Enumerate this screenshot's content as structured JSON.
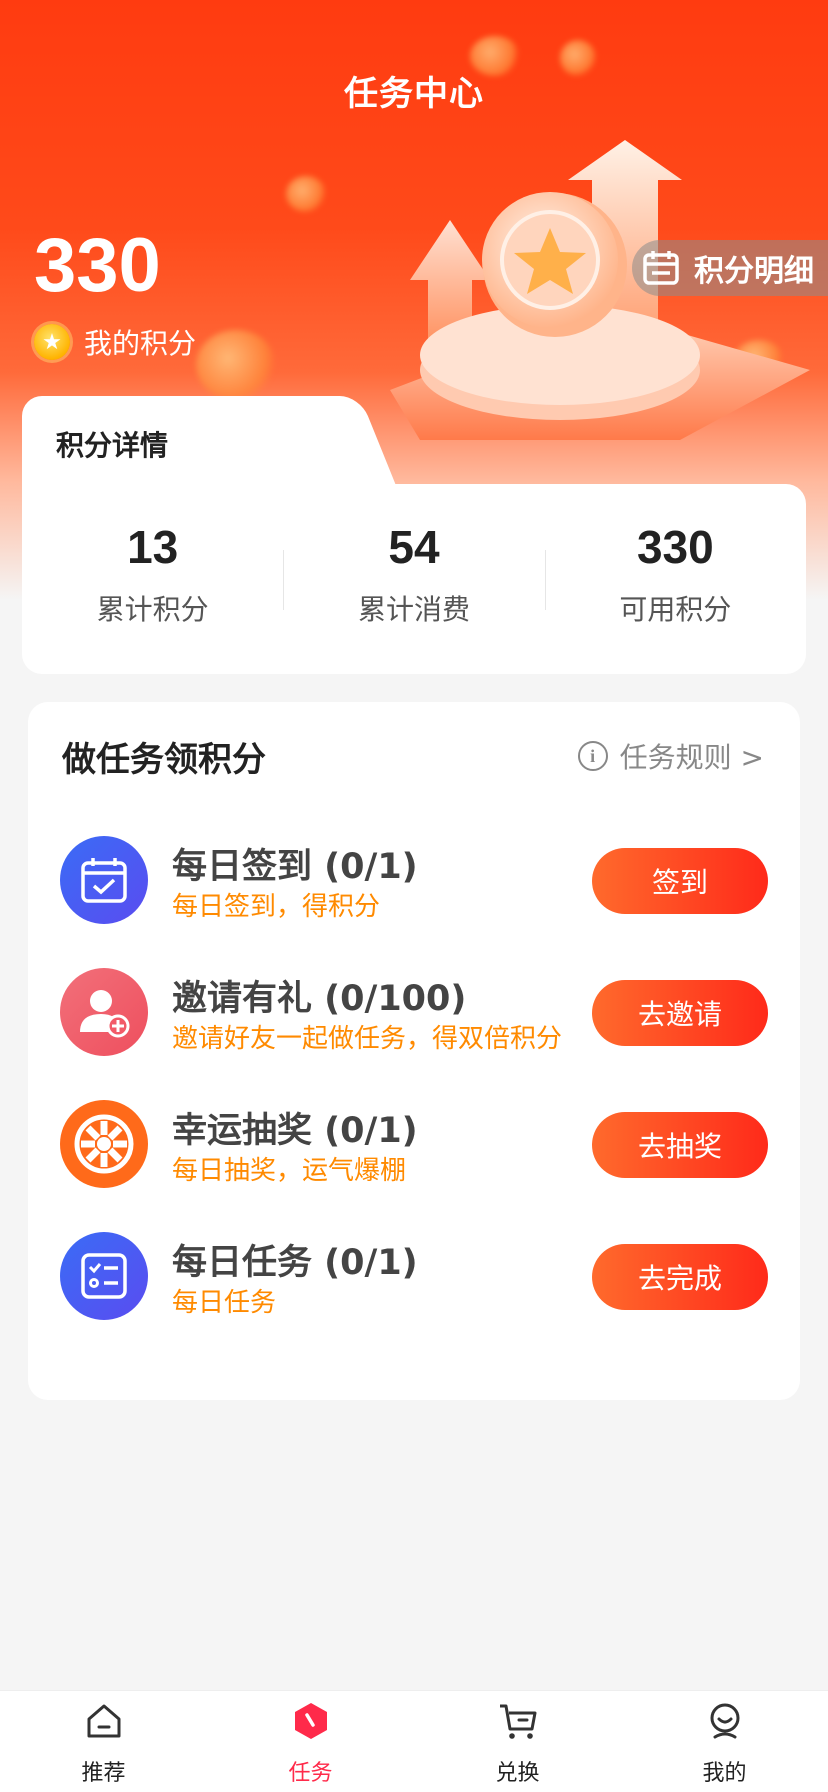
{
  "header": {
    "title": "任务中心"
  },
  "points": {
    "value": "330",
    "label": "我的积分"
  },
  "detail_link": {
    "label": "积分明细"
  },
  "points_detail": {
    "title": "积分详情",
    "stats": [
      {
        "value": "13",
        "label": "累计积分"
      },
      {
        "value": "54",
        "label": "累计消费"
      },
      {
        "value": "330",
        "label": "可用积分"
      }
    ]
  },
  "tasks": {
    "title": "做任务领积分",
    "rules_label": "任务规则 >",
    "items": [
      {
        "name": "每日签到 (0/1)",
        "desc": "每日签到，得积分",
        "button": "签到",
        "icon": "calendar-check-icon",
        "color": "#4a6cf7"
      },
      {
        "name": "邀请有礼 (0/100)",
        "desc": "邀请好友一起做任务，得双倍积分",
        "button": "去邀请",
        "icon": "invite-user-icon",
        "color": "#f25a68"
      },
      {
        "name": "幸运抽奖 (0/1)",
        "desc": "每日抽奖，运气爆棚",
        "button": "去抽奖",
        "icon": "lottery-wheel-icon",
        "color": "#ff6a1a"
      },
      {
        "name": "每日任务 (0/1)",
        "desc": "每日任务",
        "button": "去完成",
        "icon": "task-list-icon",
        "color": "#4a6cf7"
      }
    ]
  },
  "bottom_nav": {
    "items": [
      {
        "label": "推荐",
        "icon": "home-icon"
      },
      {
        "label": "任务",
        "icon": "task-icon",
        "active": true
      },
      {
        "label": "兑换",
        "icon": "cart-icon"
      },
      {
        "label": "我的",
        "icon": "profile-icon"
      }
    ]
  },
  "colors": {
    "brand": "#ff3b10",
    "accent_text": "#ff8a00",
    "nav_active": "#ff2a4a"
  }
}
